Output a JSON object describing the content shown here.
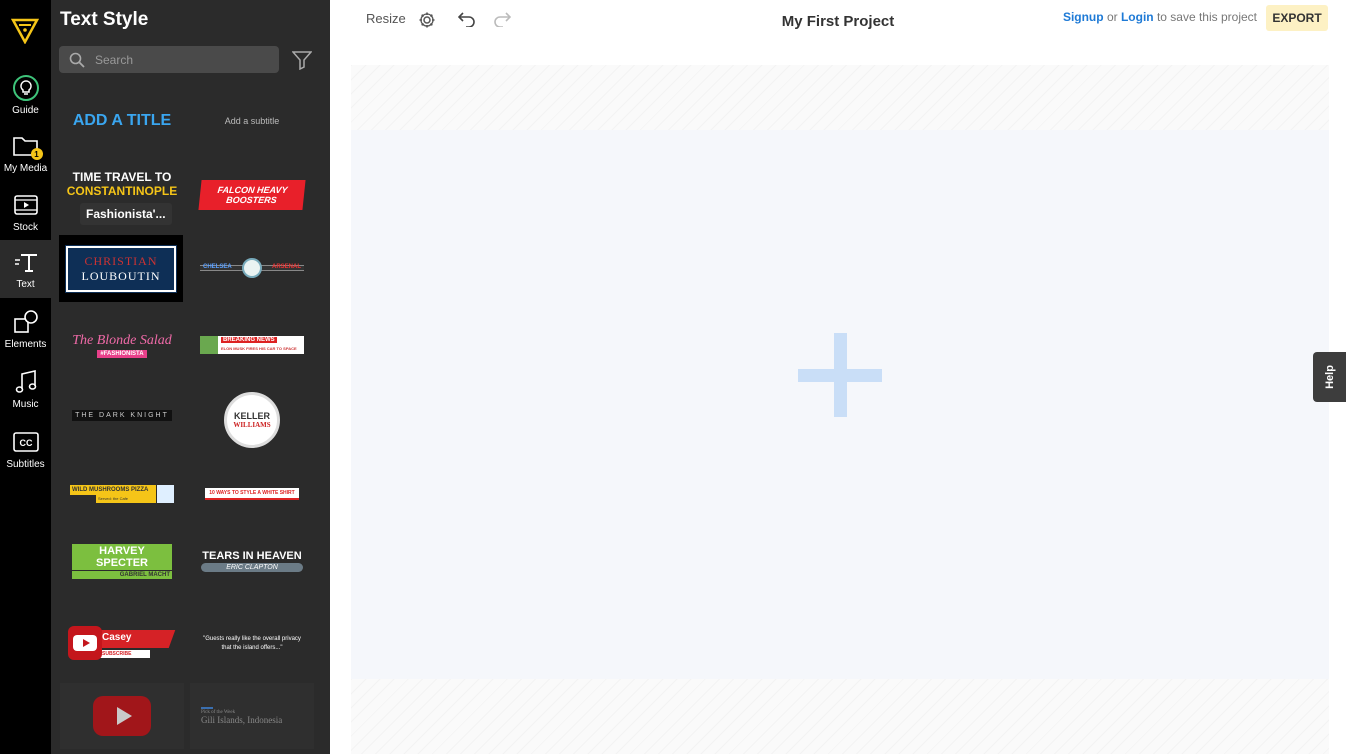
{
  "rail": {
    "items": [
      {
        "label": "Guide"
      },
      {
        "label": "My Media",
        "badge": "1"
      },
      {
        "label": "Stock"
      },
      {
        "label": "Text"
      },
      {
        "label": "Elements"
      },
      {
        "label": "Music"
      },
      {
        "label": "Subtitles"
      }
    ]
  },
  "panel": {
    "title": "Text Style",
    "search_placeholder": "Search",
    "tooltip": "Fashionista'...",
    "templates": {
      "add_title": "ADD A TITLE",
      "add_subtitle": "Add a subtitle",
      "time_travel_1": "TIME TRAVEL TO",
      "time_travel_2": "CONSTANTINOPLE",
      "falcon_1": "FALCON HEAVY",
      "falcon_2": "BOOSTERS",
      "christian_1": "CHRISTIAN",
      "christian_2": "LOUBOUTIN",
      "chelsea": "CHELSEA",
      "arsenal": "ARSENAL",
      "blonde_salad": "The Blonde Salad",
      "fashionista": "#FASHIONISTA",
      "breaking_news": "BREAKING NEWS",
      "breaking_sub": "ELON MUSK FIRES HIS CAR TO SPACE",
      "dark_knight": "THE DARK KNIGHT",
      "keller_1": "KELLER",
      "keller_2": "WILLIAMS",
      "pizza": "WILD MUSHROOMS PIZZA",
      "pizza_sub": "Served: the Cafe",
      "white_shirt": "10 WAYS TO STYLE A WHITE SHIRT",
      "harvey": "HARVEY SPECTER",
      "gabriel": "GABRIEL MACHT",
      "tears": "TEARS IN HEAVEN",
      "eric": "ERIC CLAPTON",
      "casey": "Casey",
      "subscribe": "SUBSCRIBE",
      "quote": "\"Guests really like the overall privacy that the island offers...\"",
      "pick_week": "Pick of the Week",
      "gili": "Gili Islands, Indonesia"
    }
  },
  "topbar": {
    "resize": "Resize",
    "project_title": "My First Project",
    "signup": "Signup",
    "or": " or ",
    "login": "Login",
    "save_text": " to save this project",
    "export": "EXPORT"
  },
  "help": "Help",
  "colors": {
    "accent_blue": "#1e7ad6",
    "export_bg": "#fdf1c4",
    "plus": "#c9def7"
  }
}
